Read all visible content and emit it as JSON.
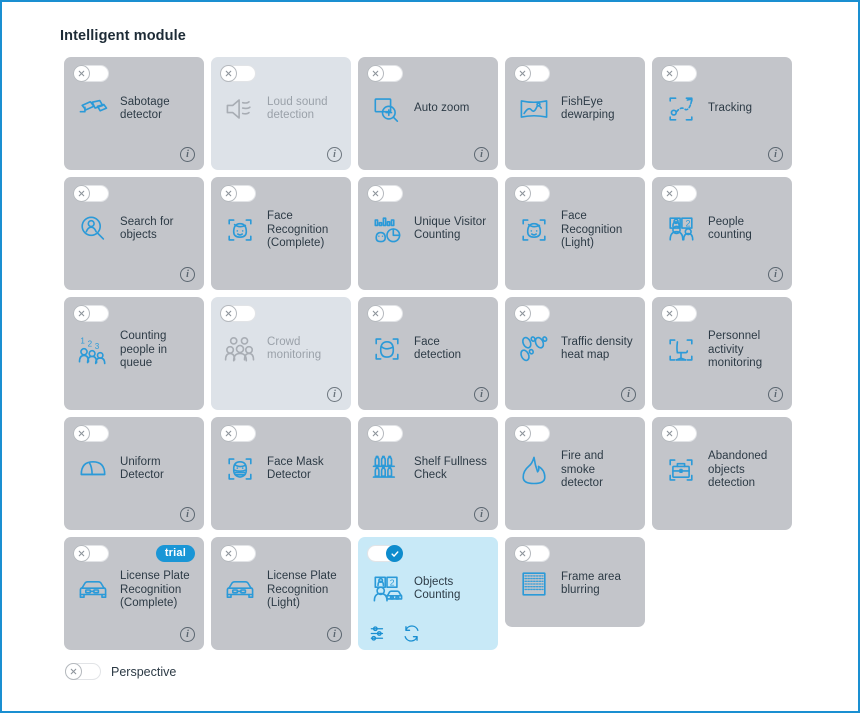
{
  "page": {
    "title": "Intelligent module",
    "accent_color": "#1a8fd1",
    "card_bg": "#c3c5ca",
    "card_bg_disabled": "#dde2e8",
    "card_bg_active": "#c8e9f7"
  },
  "modules": [
    [
      {
        "label": "Sabotage detector",
        "icon": "sabotage-camera-icon",
        "state": "off",
        "dimmed": false,
        "info": true,
        "badge": null
      },
      {
        "label": "Loud sound detection",
        "icon": "loud-sound-icon",
        "state": "off",
        "dimmed": true,
        "info": true,
        "badge": null
      },
      {
        "label": "Auto zoom",
        "icon": "auto-zoom-icon",
        "state": "off",
        "dimmed": false,
        "info": true,
        "badge": null
      },
      {
        "label": "FishEye dewarping",
        "icon": "fisheye-dewarping-icon",
        "state": "off",
        "dimmed": false,
        "info": false,
        "badge": null
      },
      {
        "label": "Tracking",
        "icon": "tracking-icon",
        "state": "off",
        "dimmed": false,
        "info": true,
        "badge": null
      }
    ],
    [
      {
        "label": "Search for objects",
        "icon": "search-person-icon",
        "state": "off",
        "dimmed": false,
        "info": true,
        "badge": null
      },
      {
        "label": "Face Recognition (Complete)",
        "icon": "face-recognition-icon",
        "state": "off",
        "dimmed": false,
        "info": false,
        "badge": null
      },
      {
        "label": "Unique Visitor Counting",
        "icon": "unique-visitor-chart-icon",
        "state": "off",
        "dimmed": false,
        "info": false,
        "badge": null
      },
      {
        "label": "Face Recognition (Light)",
        "icon": "face-recognition-icon",
        "state": "off",
        "dimmed": false,
        "info": false,
        "badge": null
      },
      {
        "label": "People counting",
        "icon": "people-counting-icon",
        "state": "off",
        "dimmed": false,
        "info": true,
        "badge": null
      }
    ],
    [
      {
        "label": "Counting people in queue",
        "icon": "queue-counting-icon",
        "state": "off",
        "dimmed": false,
        "info": false,
        "badge": null
      },
      {
        "label": "Crowd monitoring",
        "icon": "crowd-icon",
        "state": "off",
        "dimmed": true,
        "info": true,
        "badge": null
      },
      {
        "label": "Face detection",
        "icon": "face-detection-icon",
        "state": "off",
        "dimmed": false,
        "info": true,
        "badge": null
      },
      {
        "label": "Traffic density heat map",
        "icon": "footprints-icon",
        "state": "off",
        "dimmed": false,
        "info": true,
        "badge": null
      },
      {
        "label": "Personnel activity monitoring",
        "icon": "chair-monitoring-icon",
        "state": "off",
        "dimmed": false,
        "info": true,
        "badge": null
      }
    ],
    [
      {
        "label": "Uniform Detector",
        "icon": "helmet-icon",
        "state": "off",
        "dimmed": false,
        "info": true,
        "badge": null
      },
      {
        "label": "Face Mask Detector",
        "icon": "face-mask-icon",
        "state": "off",
        "dimmed": false,
        "info": false,
        "badge": null
      },
      {
        "label": "Shelf Fullness Check",
        "icon": "shelf-bottles-icon",
        "state": "off",
        "dimmed": false,
        "info": true,
        "badge": null
      },
      {
        "label": "Fire and smoke detector",
        "icon": "flame-icon",
        "state": "off",
        "dimmed": false,
        "info": false,
        "badge": null
      },
      {
        "label": "Abandoned objects detection",
        "icon": "briefcase-detection-icon",
        "state": "off",
        "dimmed": false,
        "info": false,
        "badge": null
      }
    ],
    [
      {
        "label": "License Plate Recognition (Complete)",
        "icon": "car-plate-icon",
        "state": "off",
        "dimmed": false,
        "info": true,
        "badge": "trial"
      },
      {
        "label": "License Plate Recognition (Light)",
        "icon": "car-plate-icon",
        "state": "off",
        "dimmed": false,
        "info": true,
        "badge": null
      },
      {
        "label": "Objects Counting",
        "icon": "objects-counting-icon",
        "state": "on",
        "dimmed": false,
        "info": false,
        "badge": null,
        "actions": [
          "settings-sliders-icon",
          "refresh-sync-icon"
        ]
      },
      {
        "label": "Frame area blurring",
        "icon": "frame-blur-icon",
        "state": "off",
        "dimmed": false,
        "info": false,
        "badge": null,
        "short": true
      }
    ]
  ],
  "perspective": {
    "label": "Perspective",
    "state": "off"
  }
}
